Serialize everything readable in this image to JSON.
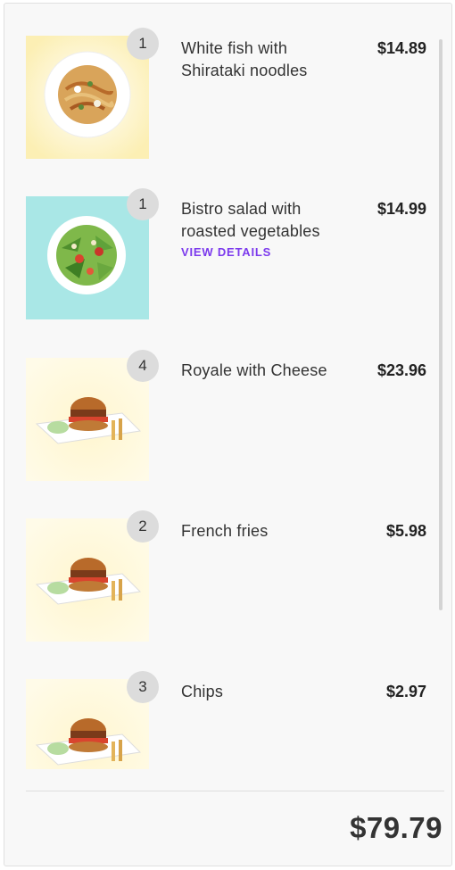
{
  "cart": {
    "items": [
      {
        "quantity": "1",
        "name": "White fish with Shirataki noodles",
        "price": "$14.89",
        "image": "noodle-dish-image",
        "bg": "#fdf4c8"
      },
      {
        "quantity": "1",
        "name": "Bistro salad with roasted vegetables",
        "price": "$14.99",
        "details": "VIEW DETAILS",
        "image": "salad-dish-image",
        "bg": "#a9e7e6"
      },
      {
        "quantity": "4",
        "name": "Royale with Cheese",
        "price": "$23.96",
        "image": "burger-dish-image",
        "bg": "#fdf3cc"
      },
      {
        "quantity": "2",
        "name": "French fries",
        "price": "$5.98",
        "image": "burger-dish-image",
        "bg": "#fdf3cc"
      },
      {
        "quantity": "3",
        "name": "Chips",
        "price": "$2.97",
        "image": "burger-dish-image",
        "bg": "#fdf3cc"
      }
    ],
    "total": "$79.79"
  },
  "colors": {
    "accent": "#7c3aed",
    "badge": "#dcdcdc",
    "card": "#f8f8f8"
  }
}
